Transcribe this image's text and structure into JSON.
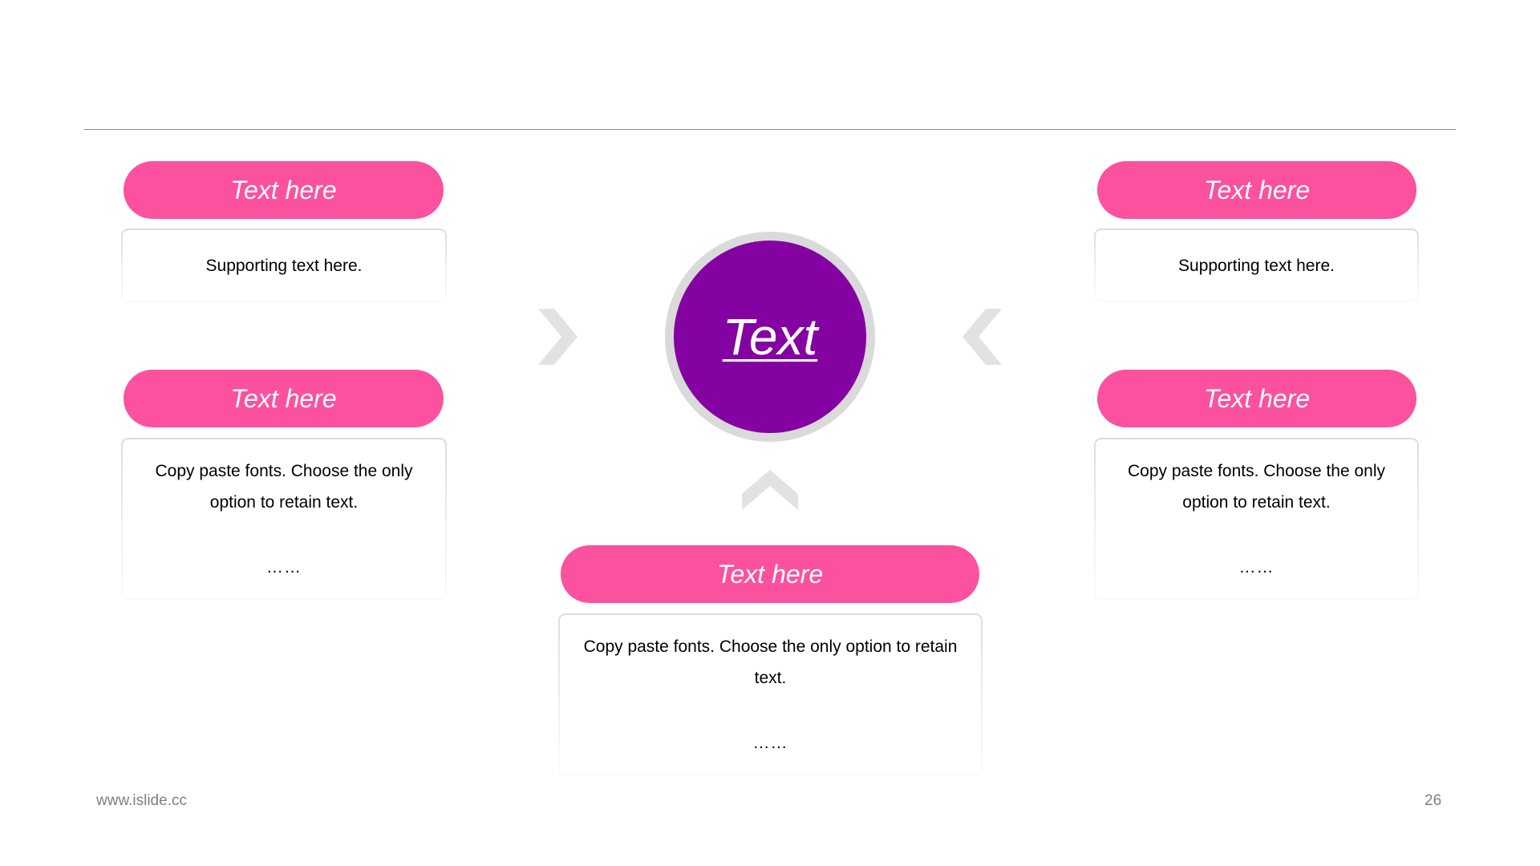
{
  "slide": {
    "center": {
      "label": "Text"
    },
    "boxes": [
      {
        "id": "top-left",
        "title": "Text here",
        "body": "Supporting text here.",
        "ellipsis": ""
      },
      {
        "id": "mid-left",
        "title": "Text here",
        "body": "Copy paste fonts. Choose the only option to retain text.",
        "ellipsis": "……"
      },
      {
        "id": "top-right",
        "title": "Text here",
        "body": "Supporting text here.",
        "ellipsis": ""
      },
      {
        "id": "mid-right",
        "title": "Text here",
        "body": "Copy paste fonts. Choose the only option to retain text.",
        "ellipsis": "……"
      },
      {
        "id": "bottom-center",
        "title": "Text here",
        "body": "Copy paste fonts. Choose the only option to retain text.",
        "ellipsis": "……"
      }
    ],
    "arrows": [
      {
        "icon": "chevron-right-icon"
      },
      {
        "icon": "chevron-left-icon"
      },
      {
        "icon": "chevron-up-icon"
      }
    ]
  },
  "colors": {
    "pill": "#FC519F",
    "center_fill": "#8502A2",
    "center_ring": "#DADADA",
    "chevron": "#E2E2E2"
  },
  "footer": {
    "url": "www.islide.cc",
    "page_number": "26"
  }
}
